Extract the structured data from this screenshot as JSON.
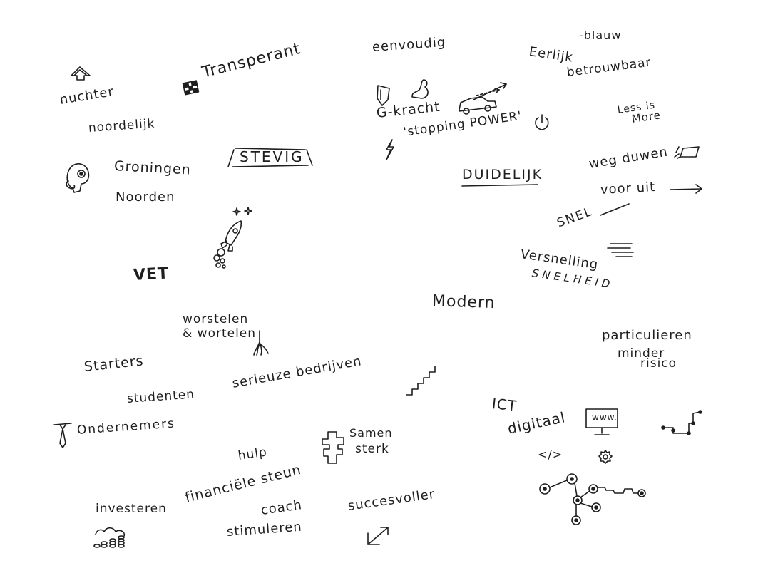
{
  "words": {
    "eenvoudig": "eenvoudig",
    "blauw": "-blauw",
    "eerlijk": "Eerlijk",
    "betrouwbaar": "betrouwbaar",
    "transperant": "Transperant",
    "nuchter": "nuchter",
    "noordelijk": "noordelijk",
    "groningen": "Groningen",
    "noorden": "Noorden",
    "stevig": "STEVIG",
    "g_kracht": "G-kracht",
    "stopping_power": "'stopping POWER'",
    "less_is": "Less is",
    "more": "More",
    "duidelijk": "DUIDELIJK",
    "weg_duwen": "weg duwen",
    "voor_uit": "voor uit",
    "snel": "SNEL",
    "versnelling": "Versnelling",
    "snelheid": "SNELHEID",
    "vet": "VET",
    "modern": "Modern",
    "worstelen": "worstelen",
    "en_wortelen": "& wortelen",
    "starters": "Starters",
    "particulieren": "particulieren",
    "minder": "minder",
    "risico": "risico",
    "serieuze_bedrijven": "serieuze bedrijven",
    "studenten": "studenten",
    "ict": "ICT",
    "digitaal": "digitaal",
    "www": "www.",
    "code": "</>",
    "ondernemers": "Ondernemers",
    "samen": "Samen",
    "sterk": "sterk",
    "hulp": "hulp",
    "financiele_steun": "financiële steun",
    "investeren": "investeren",
    "coach": "coach",
    "succesvoller": "succesvoller",
    "stimuleren": "stimuleren"
  },
  "icons": [
    "arrow-up-icon",
    "checkered-flag-icon",
    "shield-icon",
    "flexed-arm-icon",
    "car-icon",
    "lightning-icon",
    "power-icon",
    "pushing-block-icon",
    "arrow-right-icon",
    "speed-lines-icon",
    "thinking-face-icon",
    "rocket-icon",
    "stars-icon",
    "roots-icon",
    "staircase-icon",
    "monitor-icon",
    "gear-icon",
    "circuit-nodes-icon",
    "step-graph-icon",
    "tie-icon",
    "puzzle-icon",
    "coins-icon",
    "growth-arrow-icon"
  ]
}
